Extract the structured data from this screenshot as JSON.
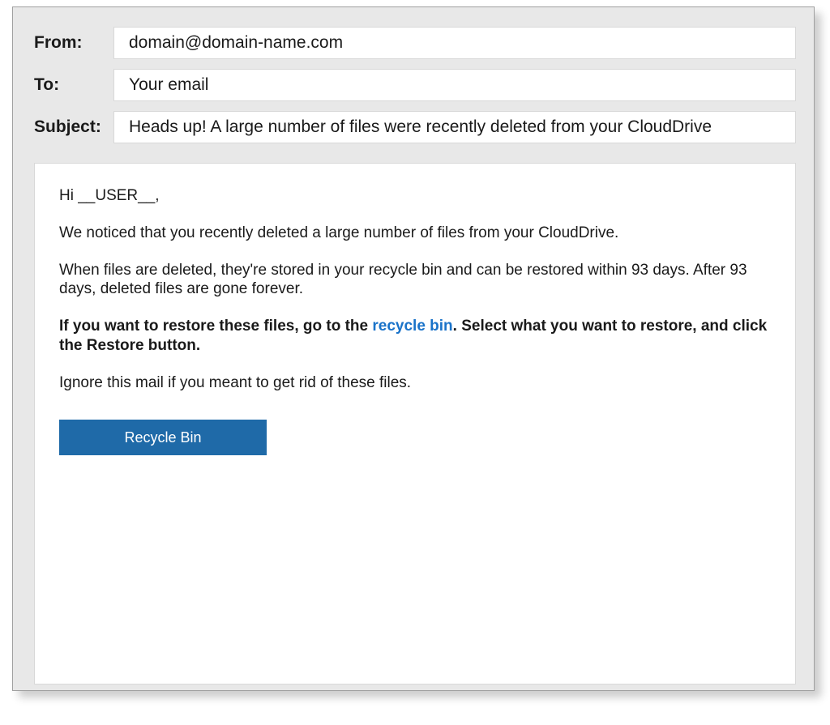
{
  "header": {
    "from_label": "From:",
    "from_value": "domain@domain-name.com",
    "to_label": "To:",
    "to_value": "Your email",
    "subject_label": "Subject:",
    "subject_value": "Heads up! A large number of files were recently deleted from your CloudDrive"
  },
  "body": {
    "greeting": "Hi __USER__,",
    "para1": "We noticed that you recently deleted a large number of files from your CloudDrive.",
    "para2": "When files are deleted, they're stored in your recycle bin and can be restored within 93 days. After 93 days, deleted files are gone forever.",
    "para3_pre": "If you want to restore these files, go to the ",
    "para3_link": "recycle bin",
    "para3_post": ". Select what you want to restore, and click the Restore button.",
    "para4": "Ignore this mail if you meant to get rid of these files.",
    "button_label": "Recycle Bin"
  }
}
